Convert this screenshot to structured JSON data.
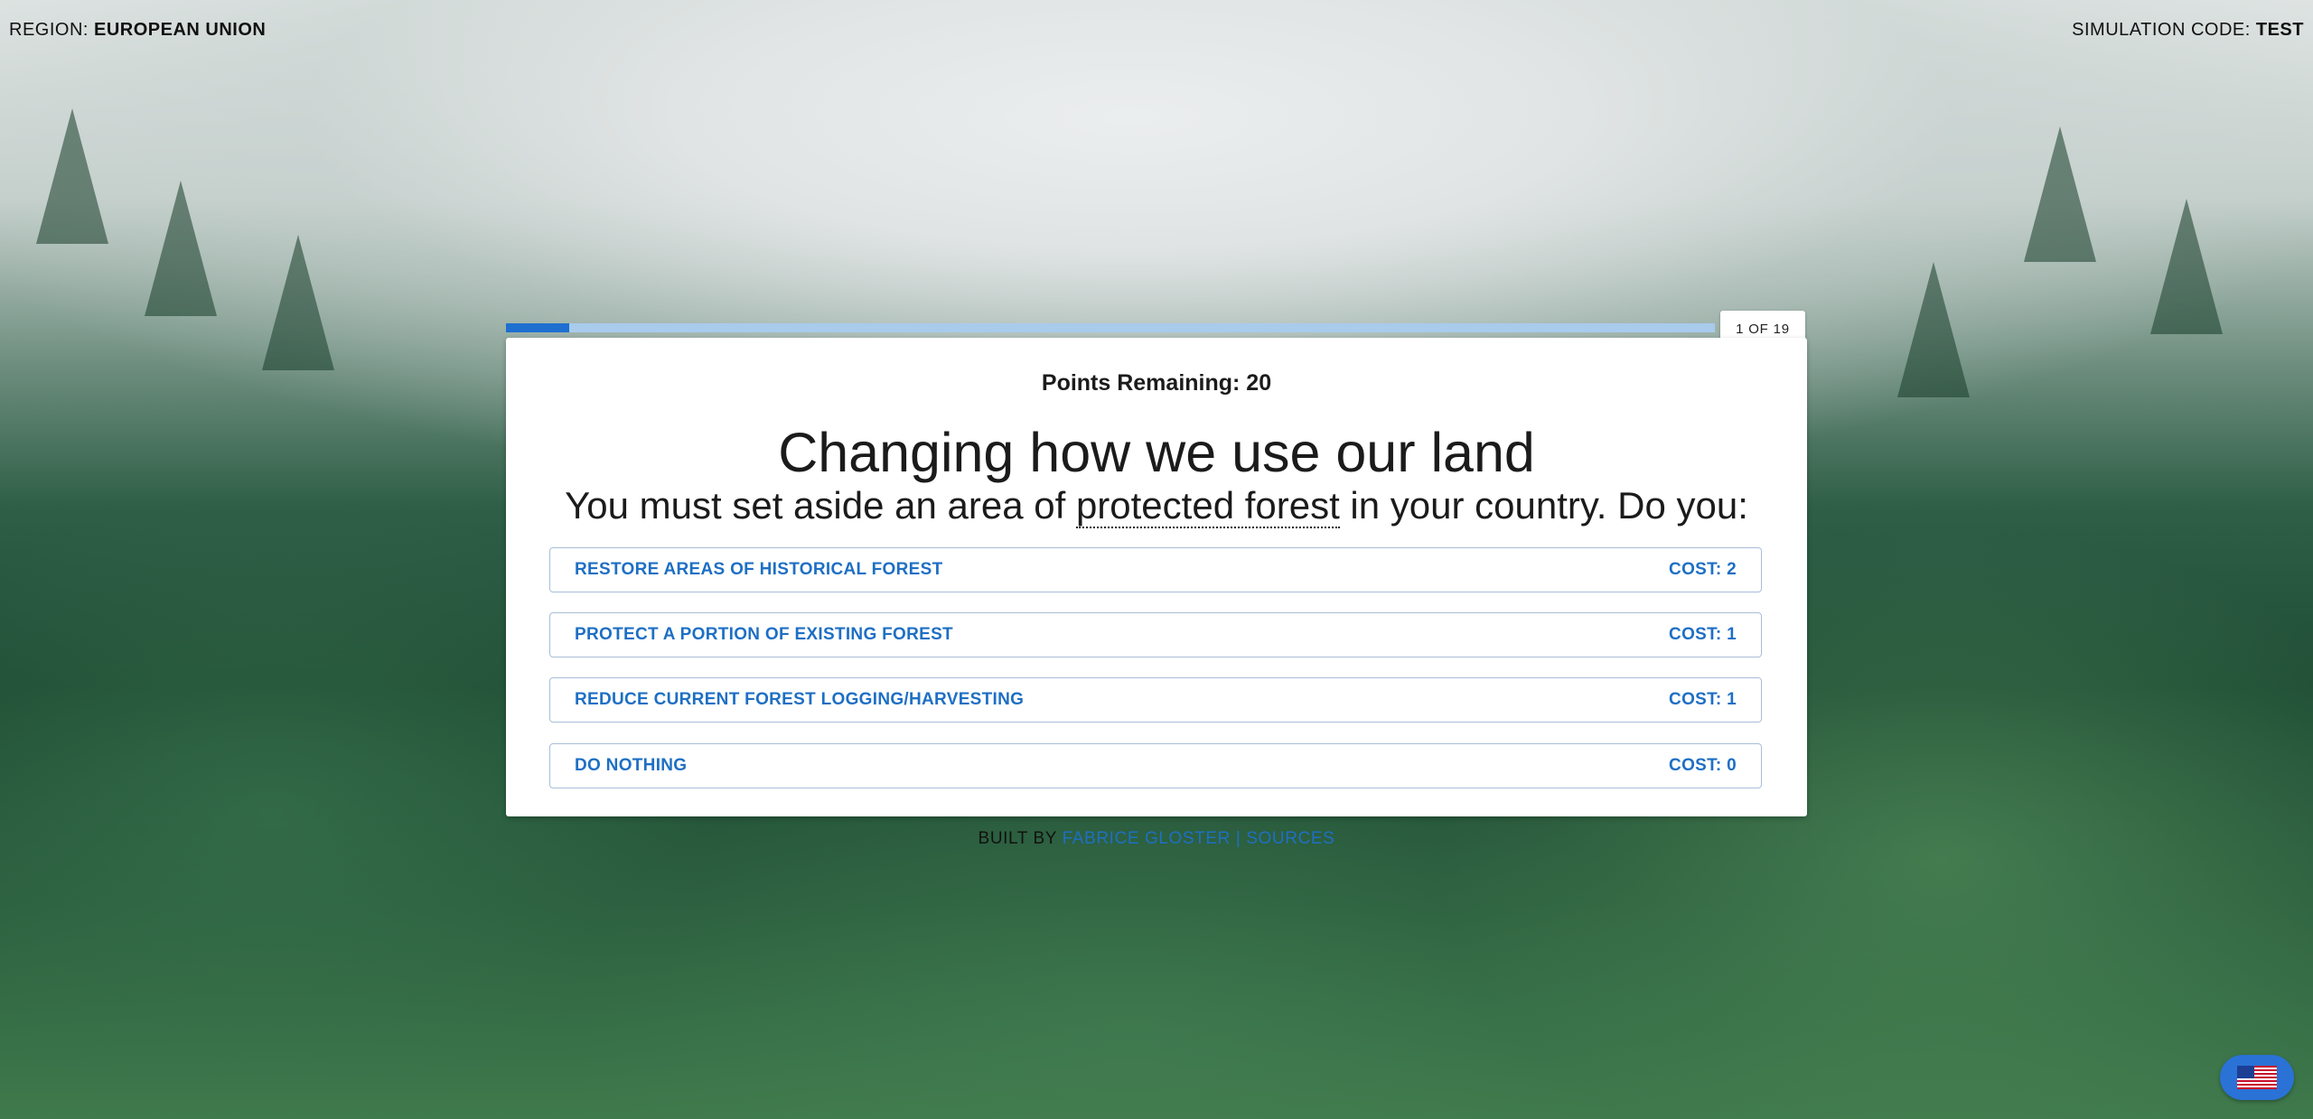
{
  "header": {
    "region_label": "REGION:",
    "region_value": "EUROPEAN UNION",
    "sim_code_label": "SIMULATION CODE:",
    "sim_code_value": "TEST"
  },
  "progress": {
    "current": 1,
    "total": 19,
    "label": "1 OF 19",
    "fill_fraction": 0.052
  },
  "card": {
    "points_remaining": "Points Remaining: 20",
    "title": "Changing how we use our land",
    "question_before": "You must set aside an area of ",
    "question_term": "protected forest",
    "question_after": " in your country. Do you:",
    "options": [
      {
        "label": "RESTORE AREAS OF HISTORICAL FOREST",
        "cost": "COST: 2"
      },
      {
        "label": "PROTECT A PORTION OF EXISTING FOREST",
        "cost": "COST: 1"
      },
      {
        "label": "REDUCE CURRENT FOREST LOGGING/HARVESTING",
        "cost": "COST: 1"
      },
      {
        "label": "DO NOTHING",
        "cost": "COST: 0"
      }
    ]
  },
  "footer": {
    "built_by": "BUILT BY ",
    "author_link": "FABRICE GLOSTER",
    "separator": " | ",
    "sources_link": "SOURCES"
  },
  "language_button": {
    "icon": "us-flag-icon"
  },
  "colors": {
    "accent": "#1e6fc4",
    "progress_fill": "#1f6fd0",
    "progress_track": "#a9cbec",
    "language_button": "#2a72d6"
  }
}
